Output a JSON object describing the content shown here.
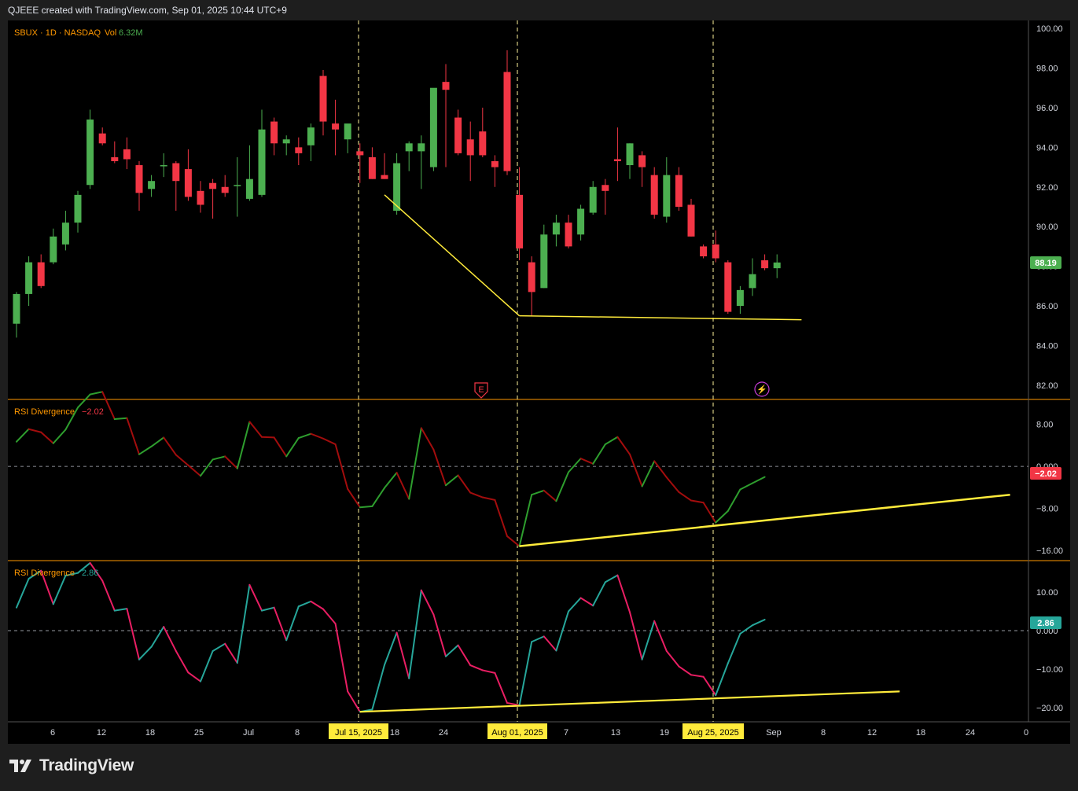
{
  "header": {
    "attribution": "QJEEE created with TradingView.com, Sep 01, 2025 10:44 UTC+9"
  },
  "footer": {
    "brand": "TradingView"
  },
  "colors": {
    "up": "#4caf50",
    "down": "#f23645",
    "background": "#000000",
    "panel_border": "#ff9800",
    "annotation": "#ffeb3b"
  },
  "price_panel": {
    "title": "SBUX · 1D · NASDAQ",
    "volume_label": "Vol",
    "volume_value": "6.32M",
    "last_price": "88.19",
    "price_axis": [
      "100.00",
      "98.00",
      "96.00",
      "94.00",
      "92.00",
      "90.00",
      "88.00",
      "86.00",
      "84.00",
      "82.00"
    ],
    "earnings_marker": "E",
    "dividend_marker": "⚡"
  },
  "rsi1": {
    "title": "RSI Divergence",
    "value": "−2.02",
    "badge": "−2.02",
    "axis": [
      "8.00",
      "0.000",
      "−8.00",
      "−16.00"
    ]
  },
  "rsi2": {
    "title": "RSI Divergence",
    "value": "2.86",
    "badge": "2.86",
    "axis": [
      "10.00",
      "0.000",
      "−10.00",
      "−20.00"
    ]
  },
  "time_axis": {
    "ticks": [
      "6",
      "12",
      "18",
      "25",
      "Jul",
      "8",
      "18",
      "24",
      "7",
      "13",
      "19",
      "Sep",
      "8",
      "12",
      "18",
      "24",
      "0"
    ],
    "highlighted": [
      "Jul 15, 2025",
      "Aug 01, 2025",
      "Aug 25, 2025"
    ]
  },
  "chart_data": [
    {
      "type": "candlestick",
      "title": "SBUX · 1D · NASDAQ",
      "ylim": [
        81.4,
        100.4
      ],
      "candles": [
        {
          "o": 85.1,
          "h": 86.7,
          "l": 84.4,
          "c": 86.6
        },
        {
          "o": 86.6,
          "h": 88.5,
          "l": 86.0,
          "c": 88.2
        },
        {
          "o": 88.2,
          "h": 88.6,
          "l": 86.9,
          "c": 87.0
        },
        {
          "o": 88.2,
          "h": 89.9,
          "l": 88.1,
          "c": 89.5
        },
        {
          "o": 89.1,
          "h": 90.8,
          "l": 88.8,
          "c": 90.2
        },
        {
          "o": 90.2,
          "h": 91.8,
          "l": 89.7,
          "c": 91.6
        },
        {
          "o": 92.1,
          "h": 95.9,
          "l": 91.9,
          "c": 95.4
        },
        {
          "o": 94.7,
          "h": 95.0,
          "l": 94.1,
          "c": 94.2
        },
        {
          "o": 93.5,
          "h": 94.3,
          "l": 93.2,
          "c": 93.3
        },
        {
          "o": 93.9,
          "h": 94.5,
          "l": 92.9,
          "c": 93.4
        },
        {
          "o": 93.1,
          "h": 93.3,
          "l": 90.8,
          "c": 91.7
        },
        {
          "o": 91.9,
          "h": 92.6,
          "l": 91.5,
          "c": 92.3
        },
        {
          "o": 93.1,
          "h": 93.7,
          "l": 92.5,
          "c": 93.1
        },
        {
          "o": 93.2,
          "h": 93.3,
          "l": 90.8,
          "c": 92.3
        },
        {
          "o": 92.9,
          "h": 93.9,
          "l": 91.3,
          "c": 91.5
        },
        {
          "o": 91.8,
          "h": 92.3,
          "l": 90.7,
          "c": 91.1
        },
        {
          "o": 92.2,
          "h": 92.4,
          "l": 90.4,
          "c": 91.9
        },
        {
          "o": 92.0,
          "h": 92.6,
          "l": 91.5,
          "c": 91.7
        },
        {
          "o": 92.1,
          "h": 93.5,
          "l": 90.5,
          "c": 92.1
        },
        {
          "o": 91.4,
          "h": 94.1,
          "l": 91.3,
          "c": 92.4
        },
        {
          "o": 91.6,
          "h": 95.9,
          "l": 91.5,
          "c": 94.9
        },
        {
          "o": 95.3,
          "h": 95.5,
          "l": 93.6,
          "c": 94.2
        },
        {
          "o": 94.2,
          "h": 94.6,
          "l": 93.6,
          "c": 94.4
        },
        {
          "o": 94.0,
          "h": 94.5,
          "l": 93.1,
          "c": 93.7
        },
        {
          "o": 94.1,
          "h": 95.2,
          "l": 93.3,
          "c": 95.0
        },
        {
          "o": 97.6,
          "h": 97.9,
          "l": 94.6,
          "c": 95.3
        },
        {
          "o": 95.2,
          "h": 96.4,
          "l": 93.6,
          "c": 94.9
        },
        {
          "o": 94.4,
          "h": 95.1,
          "l": 93.7,
          "c": 95.2
        },
        {
          "o": 93.8,
          "h": 94.2,
          "l": 92.2,
          "c": 93.6
        },
        {
          "o": 93.5,
          "h": 94.0,
          "l": 92.4,
          "c": 92.4
        },
        {
          "o": 92.6,
          "h": 93.7,
          "l": 92.4,
          "c": 92.4
        },
        {
          "o": 90.8,
          "h": 93.7,
          "l": 90.6,
          "c": 93.2
        },
        {
          "o": 93.8,
          "h": 94.3,
          "l": 92.8,
          "c": 94.2
        },
        {
          "o": 93.8,
          "h": 94.6,
          "l": 91.9,
          "c": 94.2
        },
        {
          "o": 93.0,
          "h": 95.9,
          "l": 92.8,
          "c": 97.0
        },
        {
          "o": 97.3,
          "h": 98.2,
          "l": 93.0,
          "c": 96.9
        },
        {
          "o": 95.5,
          "h": 95.9,
          "l": 93.6,
          "c": 93.7
        },
        {
          "o": 94.4,
          "h": 95.3,
          "l": 92.3,
          "c": 93.6
        },
        {
          "o": 94.8,
          "h": 96.0,
          "l": 93.5,
          "c": 93.6
        },
        {
          "o": 93.3,
          "h": 93.6,
          "l": 92.0,
          "c": 93.0
        },
        {
          "o": 97.8,
          "h": 98.9,
          "l": 92.6,
          "c": 92.8
        },
        {
          "o": 91.6,
          "h": 93.0,
          "l": 88.3,
          "c": 88.9
        },
        {
          "o": 88.2,
          "h": 88.5,
          "l": 85.5,
          "c": 86.7
        },
        {
          "o": 86.9,
          "h": 90.1,
          "l": 86.9,
          "c": 89.6
        },
        {
          "o": 89.6,
          "h": 90.6,
          "l": 89.0,
          "c": 90.2
        },
        {
          "o": 90.2,
          "h": 90.6,
          "l": 88.9,
          "c": 89.0
        },
        {
          "o": 89.6,
          "h": 91.1,
          "l": 89.3,
          "c": 90.9
        },
        {
          "o": 90.7,
          "h": 92.3,
          "l": 90.6,
          "c": 92.0
        },
        {
          "o": 92.1,
          "h": 92.4,
          "l": 90.6,
          "c": 91.8
        },
        {
          "o": 93.4,
          "h": 95.0,
          "l": 92.3,
          "c": 93.3
        },
        {
          "o": 93.1,
          "h": 94.2,
          "l": 92.4,
          "c": 94.2
        },
        {
          "o": 93.6,
          "h": 93.8,
          "l": 92.0,
          "c": 93.0
        },
        {
          "o": 92.6,
          "h": 93.0,
          "l": 90.4,
          "c": 90.6
        },
        {
          "o": 90.5,
          "h": 93.5,
          "l": 90.2,
          "c": 92.6
        },
        {
          "o": 92.6,
          "h": 93.0,
          "l": 90.8,
          "c": 91.0
        },
        {
          "o": 91.1,
          "h": 91.4,
          "l": 89.5,
          "c": 89.5
        },
        {
          "o": 89.0,
          "h": 89.1,
          "l": 88.4,
          "c": 88.5
        },
        {
          "o": 89.1,
          "h": 89.8,
          "l": 88.2,
          "c": 88.4
        },
        {
          "o": 88.2,
          "h": 88.3,
          "l": 85.6,
          "c": 85.7
        },
        {
          "o": 86.0,
          "h": 87.0,
          "l": 85.6,
          "c": 86.8
        },
        {
          "o": 86.9,
          "h": 88.4,
          "l": 86.5,
          "c": 87.6
        },
        {
          "o": 88.3,
          "h": 88.6,
          "l": 87.8,
          "c": 87.9
        },
        {
          "o": 87.9,
          "h": 88.6,
          "l": 87.4,
          "c": 88.19
        }
      ],
      "annotations": [
        {
          "type": "line",
          "points": [
            {
              "x": 30,
              "y": 91.6
            },
            {
              "x": 41,
              "y": 85.5
            }
          ]
        },
        {
          "type": "line",
          "points": [
            {
              "x": 41,
              "y": 85.5
            },
            {
              "x": 64,
              "y": 85.3
            }
          ]
        }
      ]
    },
    {
      "type": "line",
      "title": "RSI Divergence",
      "ylim": [
        -17.8,
        12.6
      ],
      "series": [
        {
          "values": [
            4.7,
            7.1,
            6.5,
            4.4,
            7.0,
            11.2,
            13.7,
            14.2,
            9.0,
            9.2,
            2.3,
            3.8,
            5.5,
            2.2,
            0.2,
            -1.8,
            1.3,
            1.9,
            -0.4,
            8.5,
            5.6,
            5.5,
            1.9,
            5.4,
            6.2,
            5.3,
            4.2,
            -4.3,
            -7.8,
            -7.6,
            -4.1,
            -1.2,
            -6.2,
            7.3,
            3.2,
            -3.6,
            -1.7,
            -5.0,
            -5.9,
            -6.4,
            -13.3,
            -15.2,
            -5.4,
            -4.6,
            -6.6,
            -1.1,
            1.5,
            0.5,
            4.2,
            5.6,
            2.3,
            -3.8,
            1.0,
            -2.1,
            -4.9,
            -6.5,
            -6.9,
            -10.7,
            -8.5,
            -4.4,
            -3.2,
            -2.02
          ]
        }
      ],
      "annotations": [
        {
          "type": "line",
          "points": [
            {
              "x": 41,
              "y": -15.2
            },
            {
              "x": 81,
              "y": -5.4
            }
          ]
        }
      ]
    },
    {
      "type": "line",
      "title": "RSI Divergence",
      "ylim": [
        -23.5,
        18.0
      ],
      "series": [
        {
          "values": [
            6.0,
            13.5,
            15.6,
            6.9,
            14.3,
            15.0,
            17.6,
            13.0,
            5.2,
            5.7,
            -7.5,
            -4.2,
            1.0,
            -5.3,
            -10.9,
            -13.2,
            -5.3,
            -3.4,
            -8.4,
            11.9,
            5.2,
            6.0,
            -2.5,
            6.3,
            7.6,
            5.6,
            1.8,
            -15.8,
            -21.1,
            -20.5,
            -8.9,
            -0.5,
            -12.4,
            10.5,
            4.2,
            -6.7,
            -3.8,
            -9.0,
            -10.3,
            -11.0,
            -18.8,
            -19.4,
            -2.9,
            -1.5,
            -5.2,
            5.0,
            8.5,
            6.5,
            12.6,
            14.4,
            4.8,
            -7.5,
            2.5,
            -5.3,
            -9.3,
            -11.5,
            -12.0,
            -16.8,
            -8.5,
            -0.8,
            1.4,
            2.86
          ]
        }
      ],
      "annotations": [
        {
          "type": "line",
          "points": [
            {
              "x": 28,
              "y": -21.1
            },
            {
              "x": 72,
              "y": -15.8
            }
          ]
        }
      ]
    }
  ]
}
